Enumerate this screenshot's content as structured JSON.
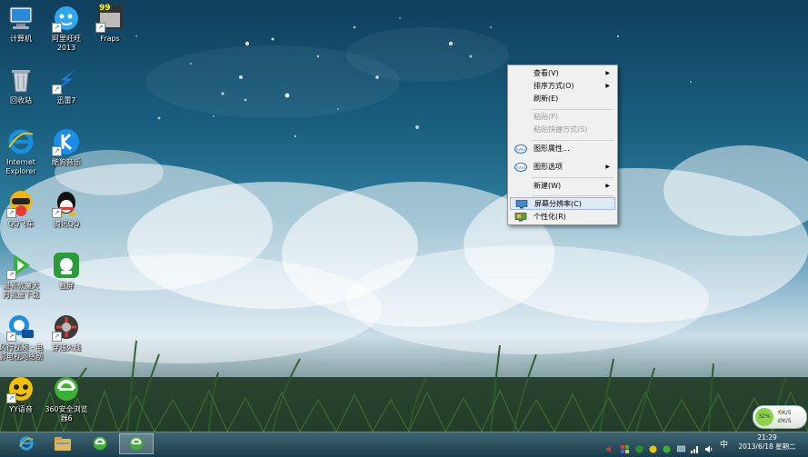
{
  "desktop_icons": [
    {
      "label": "计算机",
      "icon": "computer-icon"
    },
    {
      "label": "阿里旺旺\n2013",
      "icon": "aliwangwang-icon"
    },
    {
      "label": "Fraps",
      "icon": "fraps-icon",
      "badge": "99"
    },
    {
      "label": "回收站",
      "icon": "recycle-bin-icon"
    },
    {
      "label": "迅雷7",
      "icon": "xunlei-icon"
    },
    {
      "label": "Internet\nExplorer",
      "icon": "ie-icon"
    },
    {
      "label": "酷狗音乐",
      "icon": "kugou-icon"
    },
    {
      "label": "QQ飞车",
      "icon": "qq-speed-icon"
    },
    {
      "label": "腾讯QQ",
      "icon": "qq-icon"
    },
    {
      "label": "最新款魔天\n月流量下载",
      "icon": "download-icon"
    },
    {
      "label": "截屏",
      "icon": "screenshot-app-icon"
    },
    {
      "label": "风行视频 - 电\n影电视网络剧",
      "icon": "funshion-icon"
    },
    {
      "label": "穿越火线",
      "icon": "crossfire-icon"
    },
    {
      "label": "YY语音",
      "icon": "yy-icon"
    },
    {
      "label": "360安全浏览\n器6",
      "icon": "360-browser-icon"
    }
  ],
  "context_menu": {
    "items": [
      {
        "label": "查看(V)",
        "submenu": true,
        "disabled": false
      },
      {
        "label": "排序方式(O)",
        "submenu": true,
        "disabled": false
      },
      {
        "label": "刷新(E)",
        "submenu": false,
        "disabled": false
      },
      {
        "label": "粘贴(P)",
        "submenu": false,
        "disabled": true
      },
      {
        "label": "粘贴快捷方式(S)",
        "submenu": false,
        "disabled": true
      },
      {
        "label": "图形属性...",
        "submenu": false,
        "disabled": false,
        "icon": "intel-icon"
      },
      {
        "label": "图形选项",
        "submenu": true,
        "disabled": false,
        "icon": "intel-icon"
      },
      {
        "label": "新建(W)",
        "submenu": true,
        "disabled": false
      },
      {
        "label": "屏幕分辨率(C)",
        "submenu": false,
        "disabled": false,
        "highlighted": true,
        "icon": "display-icon"
      },
      {
        "label": "个性化(R)",
        "submenu": false,
        "disabled": false,
        "icon": "personalize-icon"
      }
    ],
    "arrow_glyph": "▶",
    "intel_text": "intel"
  },
  "net_monitor": {
    "percent": "32%",
    "up": "0K/S",
    "down": "0K/S",
    "up_arrow": "↑",
    "down_arrow": "↓"
  },
  "tray": {
    "ime": "中",
    "time": "21:29",
    "date": "2013/6/18 星期二"
  },
  "colors": {
    "menu_bg": "#f0f0f0",
    "menu_highlight": "#dfe8f6",
    "taskbar": "#2c5566"
  }
}
